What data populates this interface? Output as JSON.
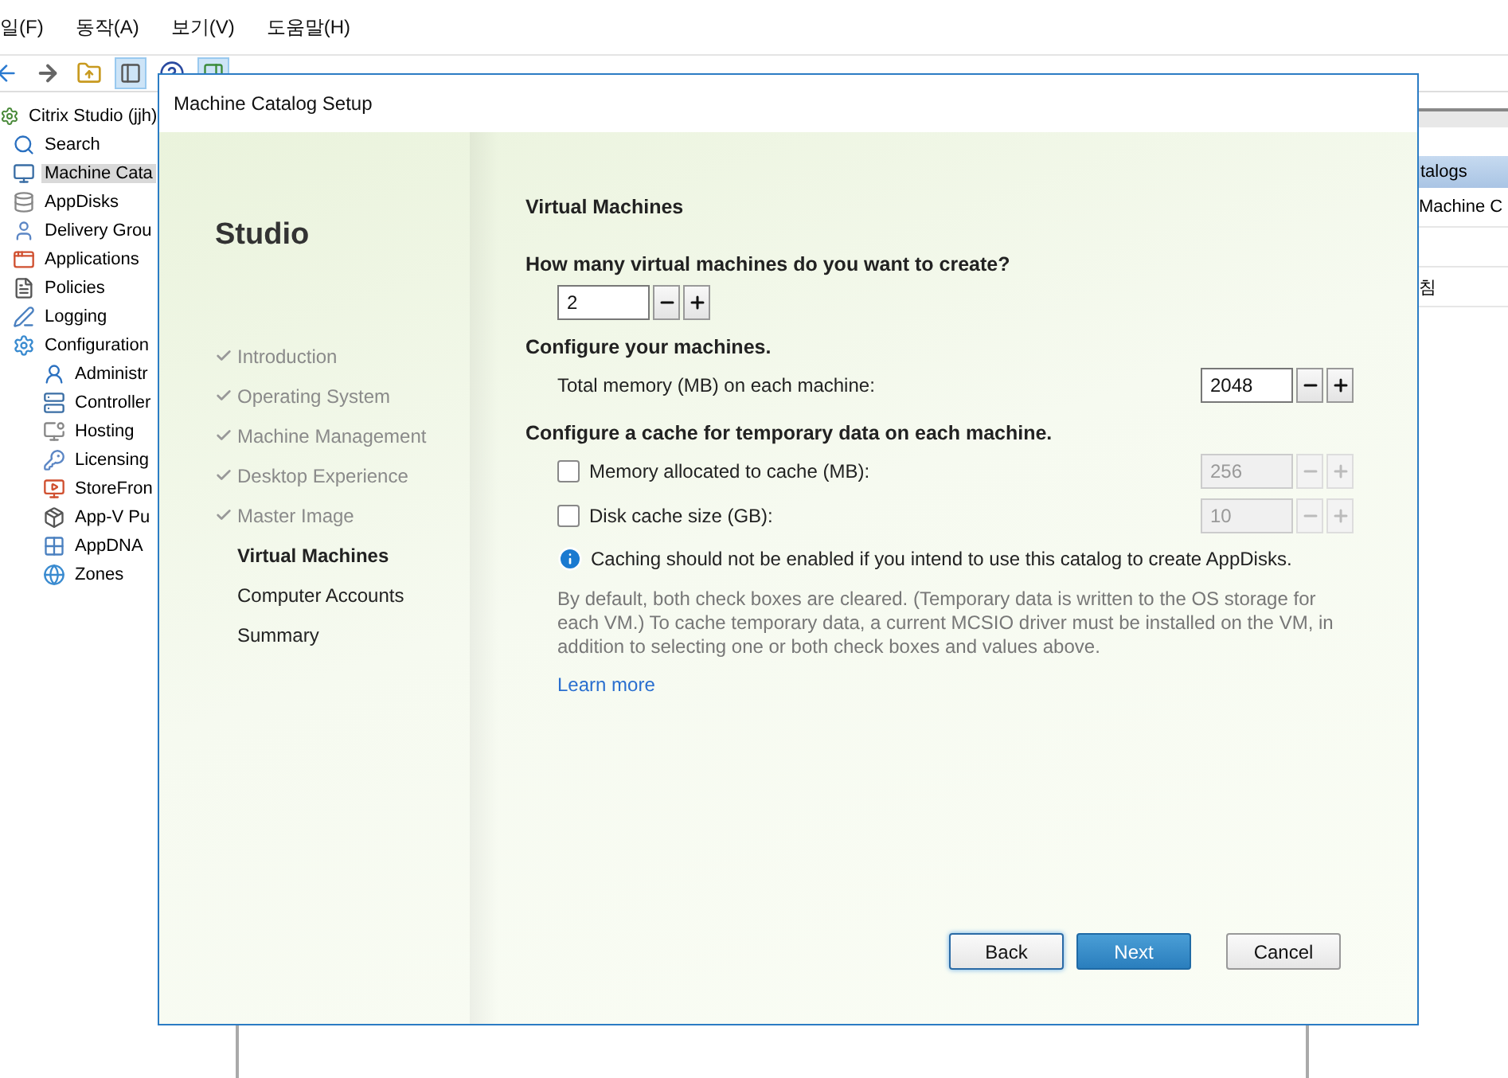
{
  "menu": [
    "일(F)",
    "동작(A)",
    "보기(V)",
    "도움말(H)"
  ],
  "tree": {
    "root": "Citrix Studio (jjh)",
    "items": [
      {
        "label": "Search",
        "selected": false
      },
      {
        "label": "Machine Cata",
        "selected": true
      },
      {
        "label": "AppDisks",
        "selected": false
      },
      {
        "label": "Delivery Grou",
        "selected": false
      },
      {
        "label": "Applications",
        "selected": false
      },
      {
        "label": "Policies",
        "selected": false
      },
      {
        "label": "Logging",
        "selected": false
      },
      {
        "label": "Configuration",
        "selected": false,
        "children": [
          {
            "label": "Administr",
            "selected": false
          },
          {
            "label": "Controller",
            "selected": false
          },
          {
            "label": "Hosting",
            "selected": false
          },
          {
            "label": "Licensing",
            "selected": false
          },
          {
            "label": "StoreFron",
            "selected": false
          },
          {
            "label": "App-V Pu",
            "selected": false
          },
          {
            "label": "AppDNA",
            "selected": false
          },
          {
            "label": "Zones",
            "selected": false
          }
        ]
      }
    ]
  },
  "right_panel": {
    "header": "talogs",
    "rows": [
      "Machine C",
      "",
      "침"
    ]
  },
  "dialog": {
    "title": "Machine Catalog Setup",
    "brand": "Studio",
    "steps": [
      {
        "label": "Introduction",
        "done": true,
        "selected": false
      },
      {
        "label": "Operating System",
        "done": true,
        "selected": false
      },
      {
        "label": "Machine Management",
        "done": true,
        "selected": false
      },
      {
        "label": "Desktop Experience",
        "done": true,
        "selected": false
      },
      {
        "label": "Master Image",
        "done": true,
        "selected": false
      },
      {
        "label": "Virtual Machines",
        "done": false,
        "selected": true
      },
      {
        "label": "Computer Accounts",
        "done": false,
        "selected": false
      },
      {
        "label": "Summary",
        "done": false,
        "selected": false
      }
    ],
    "heading": "Virtual Machines",
    "count_question": "How many virtual machines do you want to create?",
    "count_value": "2",
    "configure_heading": "Configure your machines.",
    "memory_label": "Total memory (MB) on each machine:",
    "memory_value": "2048",
    "cache_heading": "Configure a cache for temporary data on each machine.",
    "cache_options": [
      {
        "label": "Memory allocated to cache (MB):",
        "checked": false,
        "value": "256"
      },
      {
        "label": "Disk cache size (GB):",
        "checked": false,
        "value": "10"
      }
    ],
    "info": "Caching should not be enabled if you intend to use this catalog to create AppDisks.",
    "note": "By default, both check boxes are cleared. (Temporary data is written to the OS storage for each VM.) To cache temporary data, a current MCSIO driver must be installed on the VM, in addition to selecting one or both check boxes and values above.",
    "link": "Learn more",
    "buttons": [
      {
        "label": "Back",
        "kind": "focused"
      },
      {
        "label": "Next",
        "kind": "primary"
      },
      {
        "label": "Cancel",
        "kind": "normal"
      }
    ]
  }
}
